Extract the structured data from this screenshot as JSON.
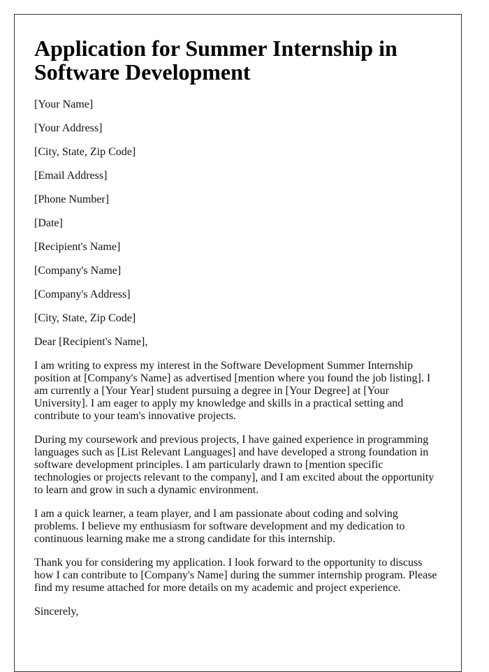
{
  "document": {
    "title": "Application for Summer Internship in Software Development",
    "sender": [
      "[Your Name]",
      "[Your Address]",
      "[City, State, Zip Code]",
      "[Email Address]",
      "[Phone Number]",
      "[Date]"
    ],
    "recipient": [
      "[Recipient's Name]",
      "[Company's Name]",
      "[Company's Address]",
      "[City, State, Zip Code]"
    ],
    "salutation": "Dear [Recipient's Name],",
    "paragraphs": [
      "I am writing to express my interest in the Software Development Summer Internship position at [Company's Name] as advertised [mention where you found the job listing]. I am currently a [Your Year] student pursuing a degree in [Your Degree] at [Your University]. I am eager to apply my knowledge and skills in a practical setting and contribute to your team's innovative projects.",
      "During my coursework and previous projects, I have gained experience in programming languages such as [List Relevant Languages] and have developed a strong foundation in software development principles. I am particularly drawn to [mention specific technologies or projects relevant to the company], and I am excited about the opportunity to learn and grow in such a dynamic environment.",
      "I am a quick learner, a team player, and I am passionate about coding and solving problems. I believe my enthusiasm for software development and my dedication to continuous learning make me a strong candidate for this internship.",
      "Thank you for considering my application. I look forward to the opportunity to discuss how I can contribute to [Company's Name] during the summer internship program. Please find my resume attached for more details on my academic and project experience."
    ],
    "closing": "Sincerely,"
  }
}
